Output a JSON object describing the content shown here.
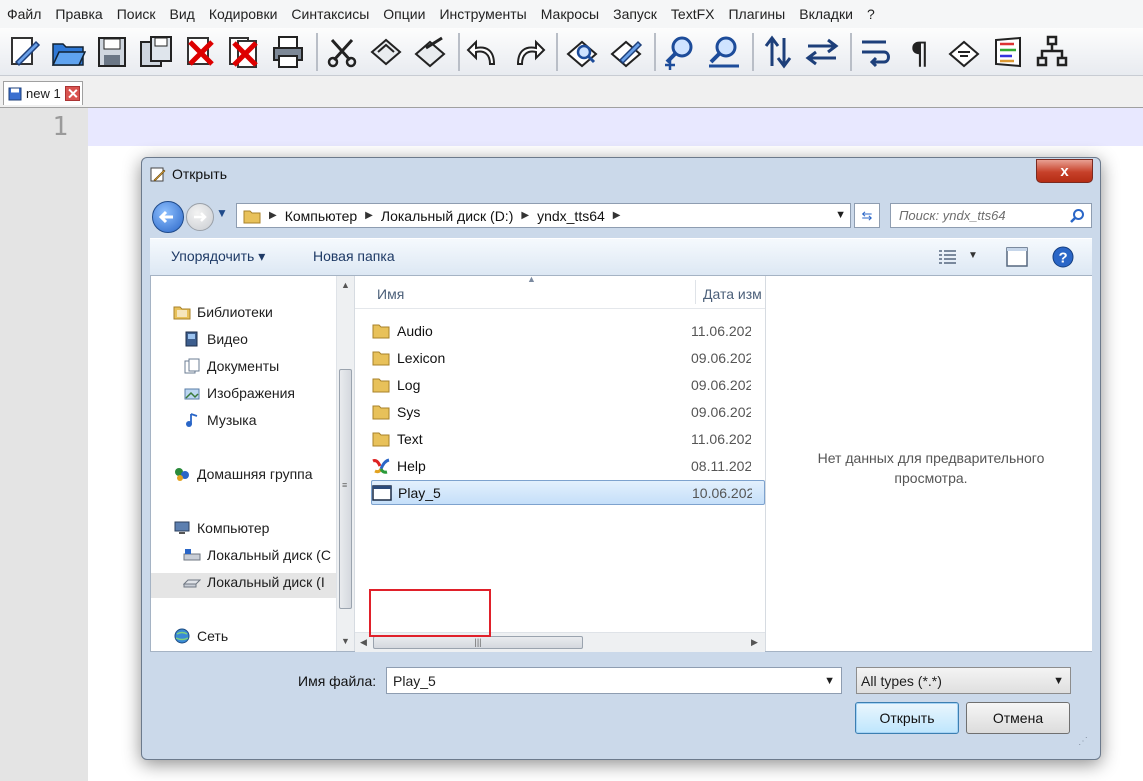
{
  "menu": [
    "Файл",
    "Правка",
    "Поиск",
    "Вид",
    "Кодировки",
    "Синтаксисы",
    "Опции",
    "Инструменты",
    "Макросы",
    "Запуск",
    "TextFX",
    "Плагины",
    "Вкладки",
    "?"
  ],
  "tab": {
    "label": "new 1"
  },
  "editor": {
    "line_number": "1"
  },
  "dialog": {
    "title": "Открыть",
    "close_label": "x",
    "breadcrumb": [
      "Компьютер",
      "Локальный диск (D:)",
      "yndx_tts64"
    ],
    "search_placeholder": "Поиск: yndx_tts64",
    "organize_label": "Упорядочить ▾",
    "new_folder_label": "Новая папка",
    "nav": {
      "libraries": "Библиотеки",
      "video": "Видео",
      "documents": "Документы",
      "images": "Изображения",
      "music": "Музыка",
      "homegroup": "Домашняя группа",
      "computer": "Компьютер",
      "disk_c": "Локальный диск (C",
      "disk_d": "Локальный диск (I",
      "network": "Сеть"
    },
    "columns": {
      "name": "Имя",
      "date": "Дата изм"
    },
    "files": [
      {
        "name": "Audio",
        "date": "11.06.202",
        "icon": "folder-icon"
      },
      {
        "name": "Lexicon",
        "date": "09.06.202",
        "icon": "folder-icon"
      },
      {
        "name": "Log",
        "date": "09.06.202",
        "icon": "folder-icon"
      },
      {
        "name": "Sys",
        "date": "09.06.202",
        "icon": "folder-icon"
      },
      {
        "name": "Text",
        "date": "11.06.202",
        "icon": "folder-icon"
      },
      {
        "name": "Help",
        "date": "08.11.202",
        "icon": "help-file-icon"
      },
      {
        "name": "Play_5",
        "date": "10.06.202",
        "icon": "app-window-icon"
      }
    ],
    "preview_text": "Нет данных для предварительного просмотра.",
    "filename_label": "Имя файла:",
    "filename_value": "Play_5",
    "filetype_value": "All types (*.*)",
    "open_button": "Открыть",
    "cancel_button": "Отмена"
  }
}
